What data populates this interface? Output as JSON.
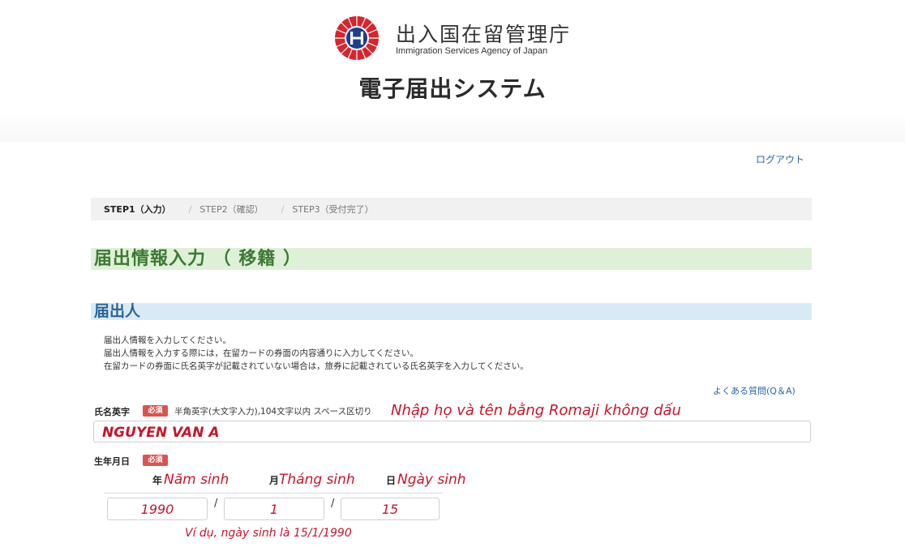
{
  "header": {
    "agency_name_jp": "出入国在留管理庁",
    "agency_name_en": "Immigration Services Agency of Japan",
    "system_title": "電子届出システム",
    "logout_label": "ログアウト"
  },
  "steps": [
    {
      "label": "STEP1（入力）",
      "active": true
    },
    {
      "label": "STEP2（確認）",
      "active": false
    },
    {
      "label": "STEP3（受付完了）",
      "active": false
    }
  ],
  "step_separator": "/",
  "sections": {
    "main_title": "届出情報入力 （ 移籍 ）",
    "applicant_title": "届出人"
  },
  "instructions": [
    "届出人情報を入力してください。",
    "届出人情報を入力する際には，在留カードの券面の内容通りに入力してください。",
    "在留カードの券面に氏名英字が記載されていない場合は，旅券に記載されている氏名英字を入力してください。"
  ],
  "faq_link": "よくある質問(Q＆A)",
  "name_field": {
    "label": "氏名英字",
    "required_badge": "必須",
    "hint": "半角英字(大文字入力),104文字以内 スペース区切り",
    "annotation": "Nhập họ và tên bằng Romaji không dấu",
    "value": "NGUYEN VAN A"
  },
  "dob_field": {
    "label": "生年月日",
    "required_badge": "必須",
    "year_unit": "年",
    "month_unit": "月",
    "day_unit": "日",
    "year_annotation": "Năm sinh",
    "month_annotation": "Tháng sinh",
    "day_annotation": "Ngày sinh",
    "year_value": "1990",
    "month_value": "1",
    "day_value": "15",
    "separator": "/",
    "example_annotation": "Ví dụ, ngày sinh là 15/1/1990"
  },
  "colors": {
    "accent_red": "#c4162a",
    "required_badge": "#d9534f",
    "section_green_bg": "#dff0d8",
    "section_green_text": "#3c7a33",
    "section_blue_bg": "#d9eaf7",
    "section_blue_text": "#2b6595",
    "link_blue": "#2a64a8"
  }
}
